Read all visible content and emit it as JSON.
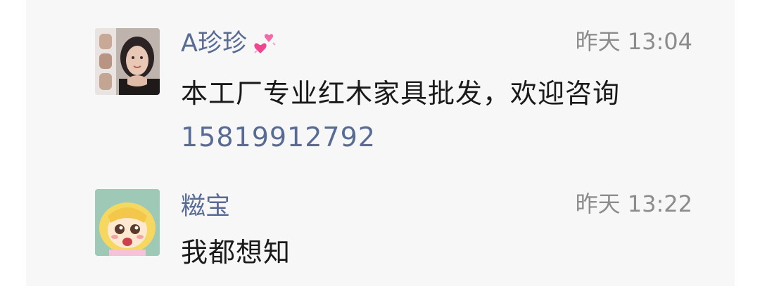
{
  "comments": [
    {
      "author": "A珍珍",
      "author_emoji": "two-hearts-emoji",
      "time": "昨天 13:04",
      "text": "本工厂专业红木家具批发，欢迎咨询",
      "phone": "15819912792",
      "avatar": "woman-photo-avatar"
    },
    {
      "author": "糍宝",
      "time": "昨天 13:22",
      "text": "我都想知",
      "avatar": "anime-girl-avatar"
    }
  ],
  "colors": {
    "panel_bg": "#f7f7f7",
    "name": "#576b95",
    "link": "#576b95",
    "time": "#8c8c8c",
    "text": "#1a1a1a"
  }
}
